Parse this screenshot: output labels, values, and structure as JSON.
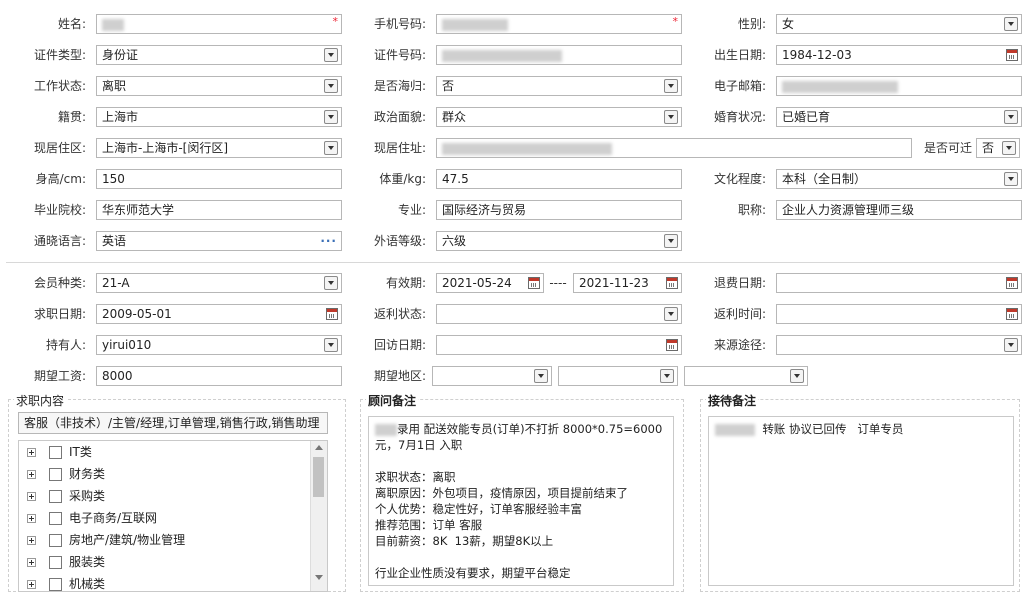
{
  "basic": {
    "name_label": "姓名:",
    "phone_label": "手机号码:",
    "gender_label": "性别:",
    "gender_value": "女",
    "id_type_label": "证件类型:",
    "id_type_value": "身份证",
    "id_no_label": "证件号码:",
    "birth_label": "出生日期:",
    "birth_value": "1984-12-03",
    "work_status_label": "工作状态:",
    "work_status_value": "离职",
    "overseas_label": "是否海归:",
    "overseas_value": "否",
    "email_label": "电子邮箱:",
    "native_label": "籍贯:",
    "native_value": "上海市",
    "political_label": "政治面貌:",
    "political_value": "群众",
    "marital_label": "婚育状况:",
    "marital_value": "已婚已育",
    "residence_label": "现居住区:",
    "residence_value": "上海市-上海市-[闵行区]",
    "address_label": "现居住址:",
    "relocate_label": "是否可迁",
    "relocate_value": "否",
    "height_label": "身高/cm:",
    "height_value": "150",
    "weight_label": "体重/kg:",
    "weight_value": "47.5",
    "education_label": "文化程度:",
    "education_value": "本科（全日制）",
    "school_label": "毕业院校:",
    "school_value": "华东师范大学",
    "major_label": "专业:",
    "major_value": "国际经济与贸易",
    "title_label": "职称:",
    "title_value": "企业人力资源管理师三级",
    "language_label": "通晓语言:",
    "language_value": "英语",
    "lang_level_label": "外语等级:",
    "lang_level_value": "六级"
  },
  "member": {
    "type_label": "会员种类:",
    "type_value": "21-A",
    "valid_label": "有效期:",
    "valid_from": "2021-05-24",
    "valid_sep": "----",
    "valid_to": "2021-11-23",
    "refund_date_label": "退费日期:",
    "apply_date_label": "求职日期:",
    "apply_date_value": "2009-05-01",
    "rebate_status_label": "返利状态:",
    "rebate_time_label": "返利时间:",
    "holder_label": "持有人:",
    "holder_value": "yirui010",
    "visit_date_label": "回访日期:",
    "source_label": "来源途径:",
    "salary_label": "期望工资:",
    "salary_value": "8000",
    "area_label": "期望地区:"
  },
  "job_content": {
    "title": "求职内容",
    "summary": "客服（非技术）/主管/经理,订单管理,销售行政,销售助理",
    "categories": [
      "IT类",
      "财务类",
      "采购类",
      "电子商务/互联网",
      "房地产/建筑/物业管理",
      "服装类",
      "机械类"
    ]
  },
  "consultant_notes": {
    "title": "顾问备注",
    "text": "录用 配送效能专员(订单)不打折 8000*0.75=6000元，7月1日 入职\n\n求职状态：离职\n离职原因：外包项目，疫情原因，项目提前结束了\n个人优势：稳定性好，订单客服经验丰富\n推荐范围：订单 客服\n目前薪资：8K  13薪，期望8K以上\n\n行业企业性质没有要求，期望平台稳定"
  },
  "reception_notes": {
    "title": "接待备注",
    "text": "转账 协议已回传   订单专员"
  },
  "icons": {
    "dropdown": "chevron-down-icon",
    "calendar": "calendar-icon",
    "more": "more-dots-icon",
    "expand": "plus-expand-icon",
    "checkbox": "checkbox-icon"
  },
  "colors": {
    "required_mark": "#ee2233",
    "more_dots": "#3a6fb6",
    "border": "#b7b7b7"
  }
}
